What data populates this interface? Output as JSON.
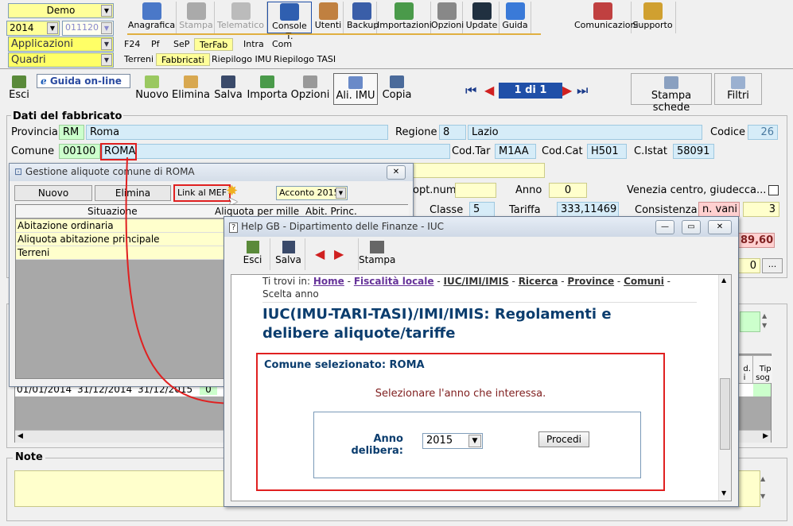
{
  "top": {
    "demo_combo": "Demo",
    "year_combo": "2014",
    "code_combo": "011120 -",
    "applicazioni": "Applicazioni",
    "quadri": "Quadri"
  },
  "toolbar": [
    {
      "name": "anagrafica-button",
      "label": "Anagrafica",
      "icon": "notebook-icon",
      "color": "#4a78c8"
    },
    {
      "name": "stampa-button",
      "label": "Stampa",
      "icon": "printer-icon",
      "color": "#aaaaaa",
      "disabled": true
    },
    {
      "name": "telematico-button",
      "label": "Telematico",
      "icon": "telematico-icon",
      "color": "#bbbbbb",
      "disabled": true
    },
    {
      "name": "console-button",
      "label": "Console T.",
      "icon": "console-icon",
      "color": "#2f5fb0"
    },
    {
      "name": "utenti-button",
      "label": "Utenti",
      "icon": "users-icon",
      "color": "#c08040"
    },
    {
      "name": "backup-button",
      "label": "Backup",
      "icon": "backup-icon",
      "color": "#3a5ea8"
    },
    {
      "name": "importazioni-button",
      "label": "Importazioni",
      "icon": "import-icon",
      "color": "#4a9a4a"
    },
    {
      "name": "opzioni-button",
      "label": "Opzioni",
      "icon": "tools-icon",
      "color": "#888888"
    },
    {
      "name": "update-button",
      "label": "Update",
      "icon": "monitor-icon",
      "color": "#203040"
    },
    {
      "name": "guida-button",
      "label": "Guida",
      "icon": "help-icon",
      "color": "#3a7ad8"
    },
    {
      "name": "comunicazioni-button",
      "label": "Comunicazioni",
      "icon": "messages-icon",
      "color": "#c04040"
    },
    {
      "name": "supporto-button",
      "label": "Supporto",
      "icon": "support-icon",
      "color": "#d0a030"
    }
  ],
  "tabs_row1": [
    "F24",
    "Pf",
    "SeP",
    "TerFab",
    "Intra",
    "Com"
  ],
  "tabs_row2": [
    "Terreni",
    "Fabbricati",
    "Riepilogo IMU",
    "Riepilogo TASI"
  ],
  "form_toolbar": {
    "esci": "Esci",
    "guida_online": "Guida on-line",
    "nuovo": "Nuovo",
    "elimina": "Elimina",
    "salva": "Salva",
    "importa": "Importa",
    "opzioni": "Opzioni",
    "ali_imu": "Ali. IMU",
    "copia": "Copia",
    "pager": "1 di 1",
    "stampa_schede": "Stampa schede",
    "filtri": "Filtri"
  },
  "fabbricato": {
    "section_title": "Dati del fabbricato",
    "provincia_label": "Provincia",
    "provincia_code": "RM",
    "provincia_name": "Roma",
    "regione_label": "Regione",
    "regione_code": "8",
    "regione_name": "Lazio",
    "codice_label": "Codice",
    "codice_value": "26",
    "comune_label": "Comune",
    "comune_code": "00100",
    "comune_name": "ROMA",
    "codtar_label": "Cod.Tar",
    "codtar_value": "M1AA",
    "codcat_label": "Cod.Cat",
    "codcat_value": "H501",
    "cistat_label": "C.Istat",
    "cistat_value": "58091",
    "optnum_label": "opt.num",
    "anno_label": "Anno",
    "anno_value": "0",
    "venezia_label": "Venezia centro, giudecca...",
    "classe_label": "Classe",
    "classe_value": "5",
    "tariffa_label": "Tariffa",
    "tariffa_value": "333,11469",
    "consistenza_label": "Consistenza",
    "consistenza_unit": "n. vani",
    "consistenza_value": "3",
    "rendita_value": "89,60",
    "zero_value": "0",
    "ellipsis": "..."
  },
  "lower": {
    "row_date1": "01/01/2014",
    "row_date2": "31/12/2014",
    "row_date3": "31/12/2015",
    "row_zero": "0",
    "col_d": "d.\ni",
    "col_tip": "Tip\nsog",
    "note_title": "Note"
  },
  "aliquote_window": {
    "title": "Gestione aliquote comune di ROMA",
    "nuovo": "Nuovo",
    "elimina": "Elimina",
    "link_mef": "Link al MEF",
    "acconto": "Acconto 2015",
    "col_situazione": "Situazione",
    "col_aliquota": "Aliquota per mille",
    "col_abit": "Abit. Princ.",
    "rows": [
      "Abitazione ordinaria",
      "Aliquota abitazione principale",
      "Terreni"
    ]
  },
  "help_window": {
    "title": "Help GB - Dipartimento delle Finanze - IUC",
    "esci": "Esci",
    "salva": "Salva",
    "stampa": "Stampa",
    "breadcrumb_prefix": "Ti trovi in:",
    "breadcrumb": [
      "Home",
      "Fiscalità locale",
      "IUC/IMI/IMIS",
      "Ricerca",
      "Province",
      "Comuni"
    ],
    "breadcrumb_last": "Scelta anno",
    "heading": "IUC(IMU-TARI-TASI)/IMI/IMIS: Regolamenti e delibere aliquote/tariffe",
    "comune_sel": "Comune selezionato: ROMA",
    "select_text": "Selezionare l'anno che interessa.",
    "anno_label": "Anno\ndelibera:",
    "anno_value": "2015",
    "procedi": "Procedi"
  },
  "colors": {
    "highlight_red": "#e02020",
    "title_blue": "#0b3d6e",
    "field_blue": "#d6ecf8",
    "field_green": "#ccffcc"
  }
}
